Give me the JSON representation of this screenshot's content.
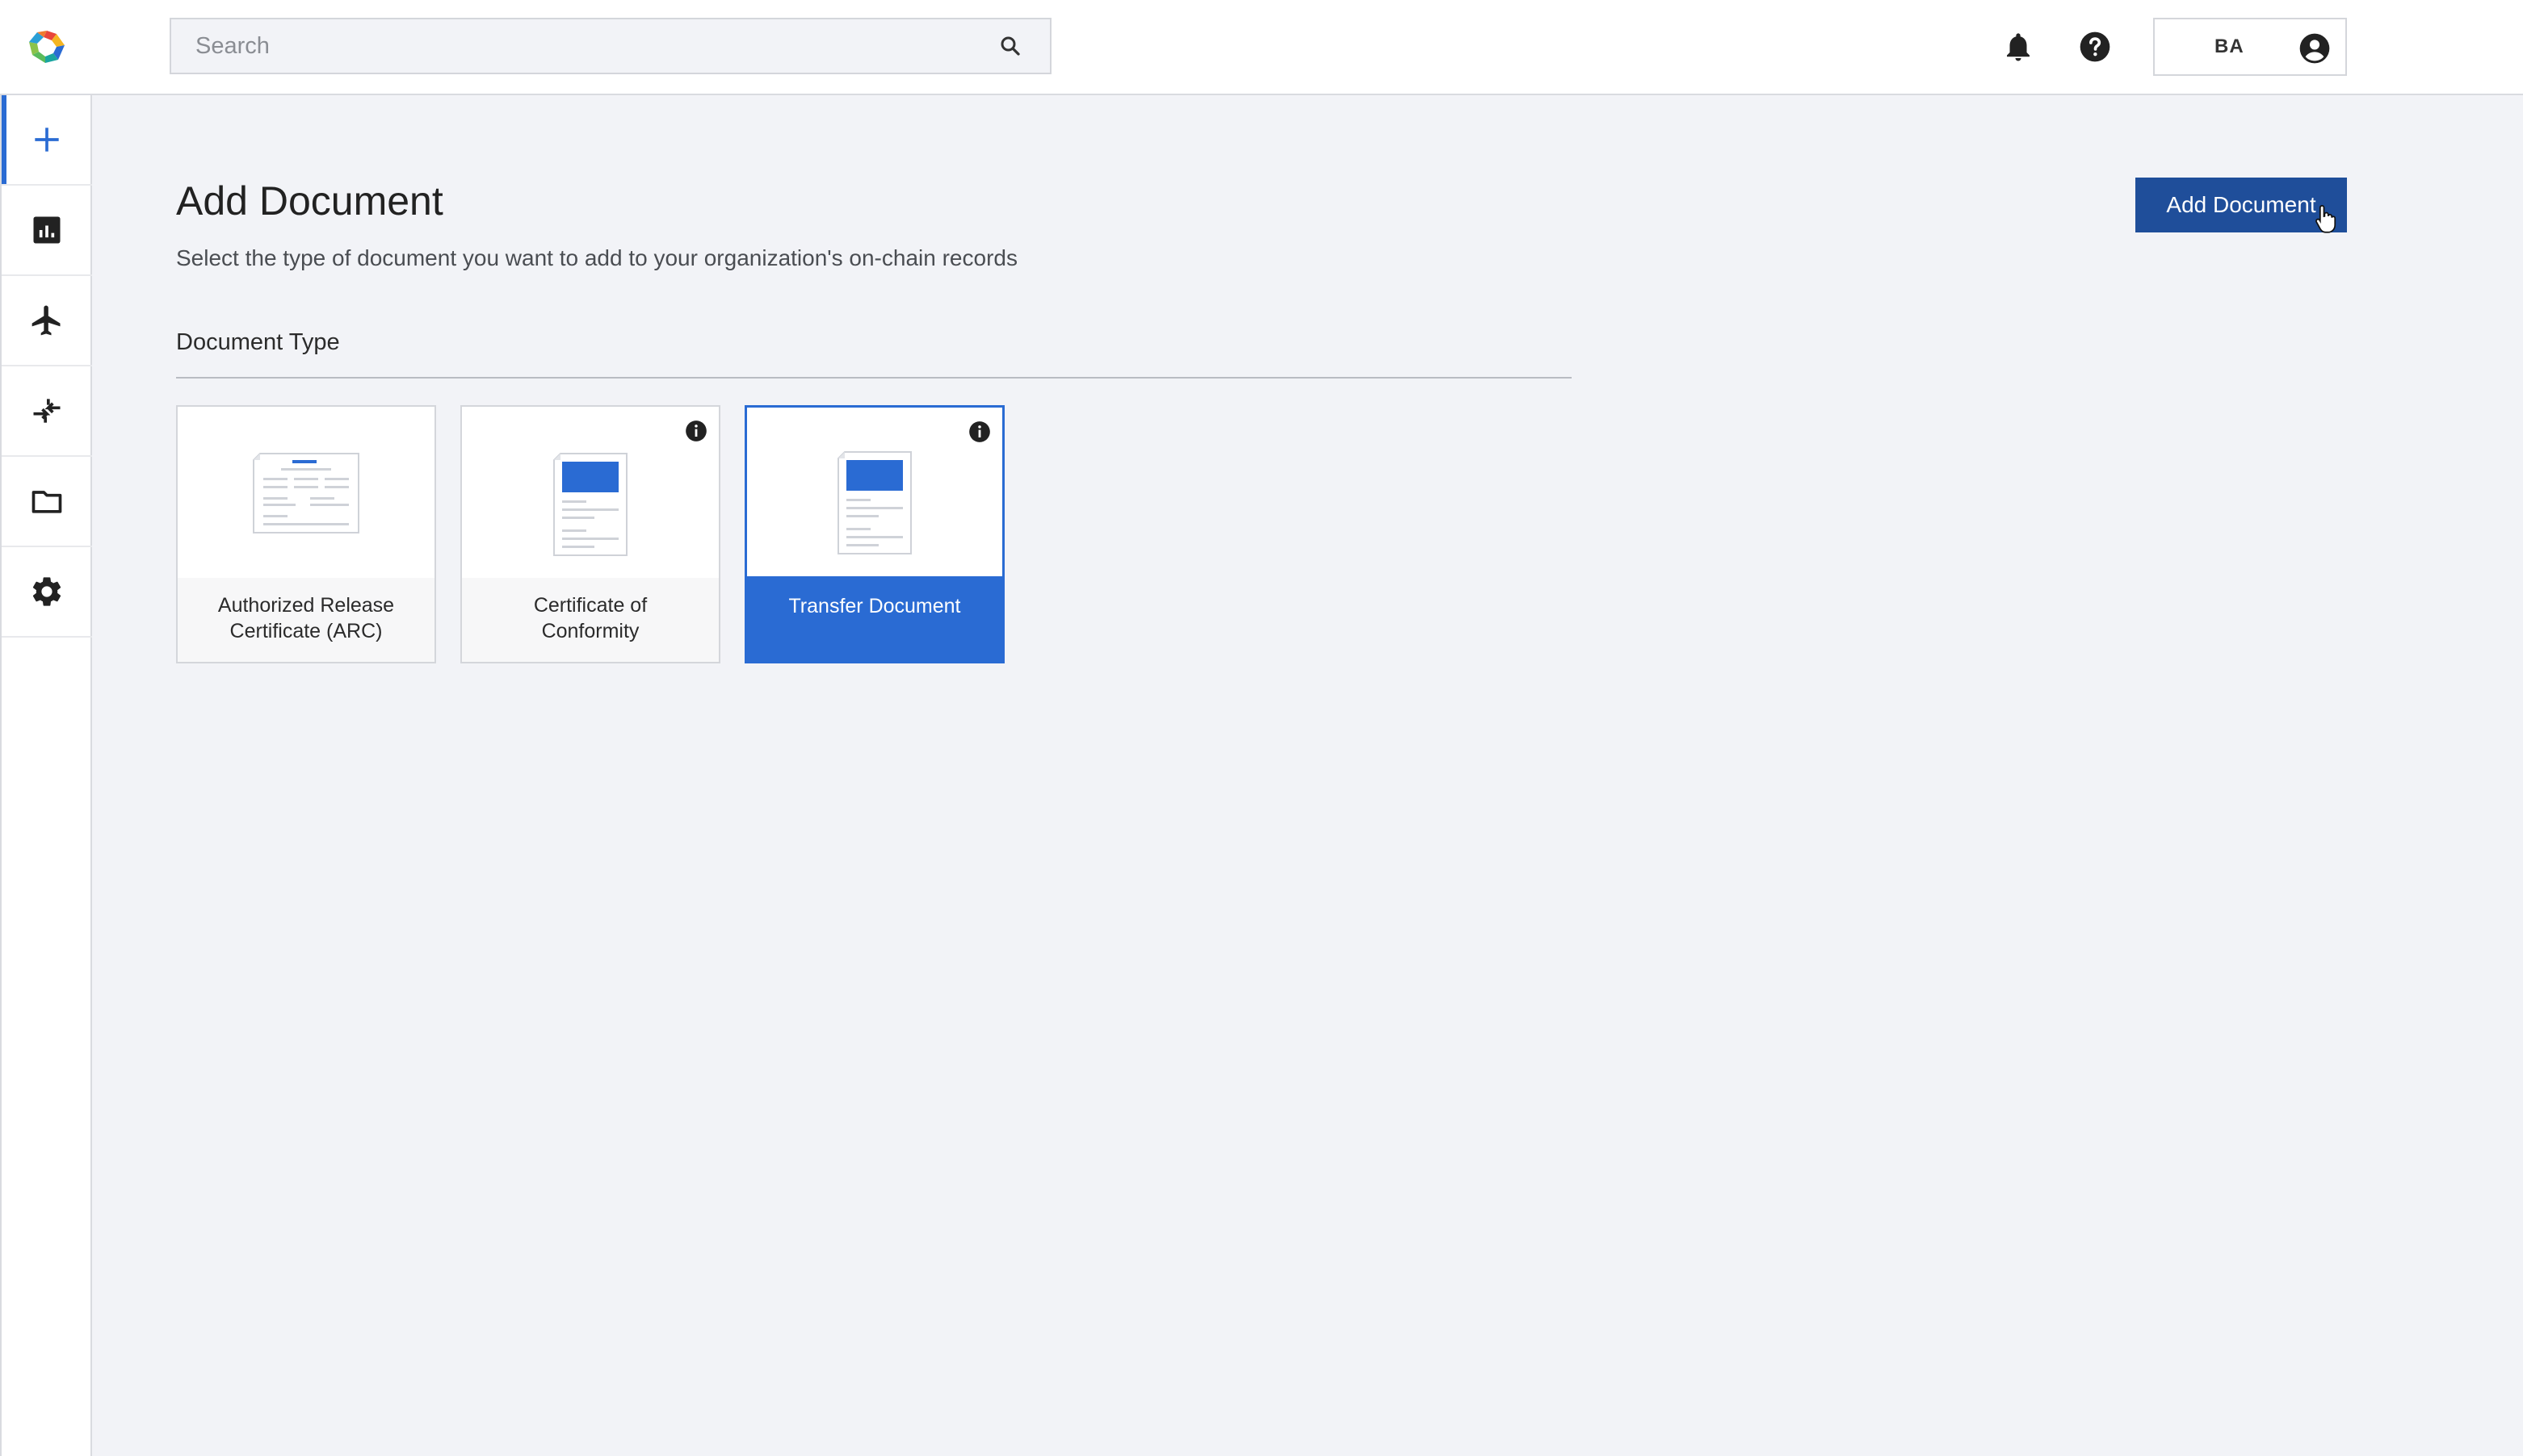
{
  "header": {
    "search": {
      "placeholder": "Search"
    },
    "user": {
      "initials": "BA"
    }
  },
  "sidebar": {
    "items": [
      {
        "name": "add",
        "icon": "plus-icon",
        "active": true
      },
      {
        "name": "reports",
        "icon": "bar-chart-icon"
      },
      {
        "name": "aircraft",
        "icon": "airplane-icon"
      },
      {
        "name": "transfers",
        "icon": "transfer-arrows-icon"
      },
      {
        "name": "documents",
        "icon": "folder-icon"
      },
      {
        "name": "settings",
        "icon": "gear-icon"
      }
    ]
  },
  "main": {
    "title": "Add Document",
    "subtitle": "Select the type of document you want to add to your organization's on-chain records",
    "add_button_label": "Add Document",
    "section_label": "Document Type",
    "cards": [
      {
        "label_line1": "Authorized Release",
        "label_line2": "Certificate (ARC)",
        "selected": false
      },
      {
        "label_line1": "Certificate of",
        "label_line2": "Conformity",
        "selected": false
      },
      {
        "label_line1": "Transfer Document",
        "label_line2": "",
        "selected": true
      }
    ]
  },
  "colors": {
    "accent": "#2a6bd3",
    "button": "#1f4e9a",
    "background": "#f2f3f7"
  }
}
